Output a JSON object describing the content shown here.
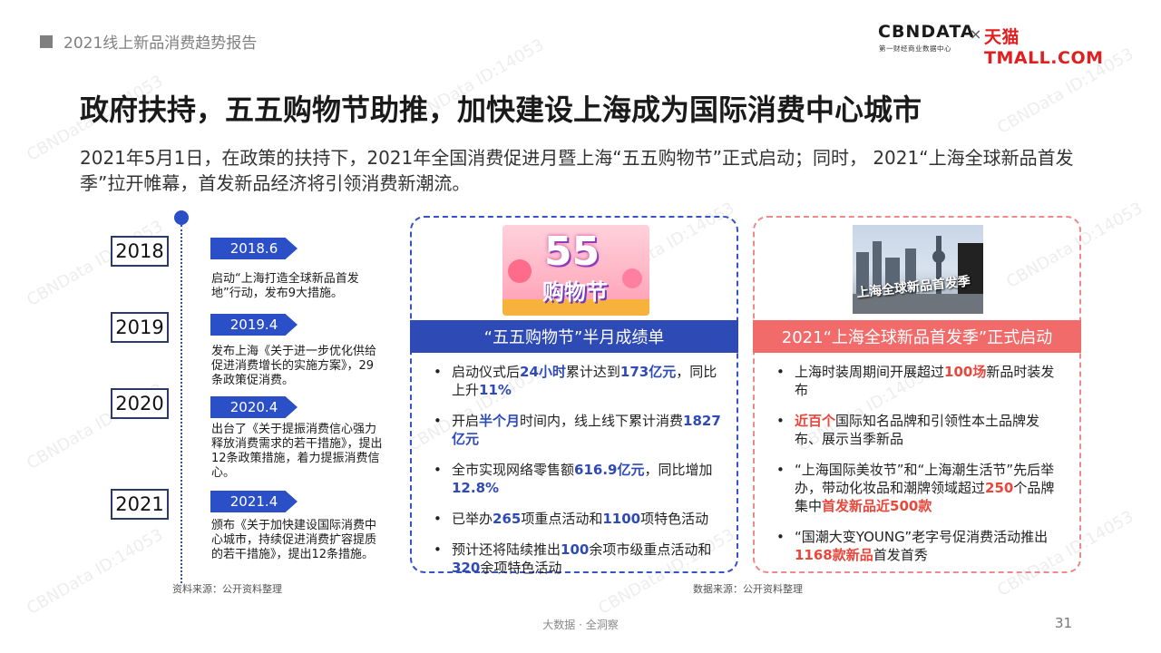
{
  "header": {
    "report_title": "2021线上新品消费趋势报告",
    "logo_cbn": "CBNDATA",
    "logo_cbn_sub": "第一财经商业数据中心",
    "logo_sep": "×",
    "logo_tmall": "天猫TMALL.COM"
  },
  "title": "政府扶持，五五购物节助推，加快建设上海成为国际消费中心城市",
  "intro": "2021年5月1日，在政策的扶持下，2021年全国消费促进月暨上海“五五购物节”正式启动；同时， 2021“上海全球新品首发季”拉开帷幕，首发新品经济将引领消费新潮流。",
  "watermark": "CBNData ID:14053",
  "timeline": [
    {
      "year": "2018",
      "date": "2018.6",
      "text": "启动“上海打造全球新品首发地”行动，发布9大措施。"
    },
    {
      "year": "2019",
      "date": "2019.4",
      "text": "发布上海《关于进一步优化供给促进消费增长的实施方案》，29条政策促消费。"
    },
    {
      "year": "2020",
      "date": "2020.4",
      "text": "出台了《关于提振消费信心强力释放消费需求的若干措施》，提出12条政策措施，着力提振消费信心。"
    },
    {
      "year": "2021",
      "date": "2021.4",
      "text": "颁布《关于加快建设国际消费中心城市，持续促进消费扩容提质的若干措施》，提出12条措施。"
    }
  ],
  "source_left": "资料来源：公开资料整理",
  "source_mid": "数据来源：公开资料整理",
  "card_left": {
    "image_text_big": "55",
    "image_text_small": "购物节",
    "banner": "“五五购物节”半月成绩单",
    "bullet": "•",
    "items": [
      [
        "启动仪式后",
        "24小时",
        "累计达到",
        "173亿元",
        "，同比上升",
        "11%",
        ""
      ],
      [
        "开启",
        "半个月",
        "时间内，线上线下累计消费",
        "1827亿元",
        "",
        "",
        ""
      ],
      [
        "全市实现网络零售额",
        "616.9亿元",
        "，同比增加",
        "12.8%",
        "",
        "",
        ""
      ],
      [
        "已举办",
        "265",
        "项重点活动和",
        "1100",
        "项特色活动",
        "",
        ""
      ],
      [
        "预计还将陆续推出",
        "100",
        "余项市级重点活动和",
        "320",
        "余项特色活动",
        "",
        ""
      ]
    ]
  },
  "card_right": {
    "image_caption": "上海全球新品首发季",
    "banner": "2021“上海全球新品首发季”正式启动",
    "bullet": "•",
    "items": [
      [
        "上海时装周期间开展超过",
        "100场",
        "新品时装发布",
        "",
        "",
        "",
        ""
      ],
      [
        "",
        "近百个",
        "国际知名品牌和引领性本土品牌发布、展示当季新品",
        "",
        "",
        "",
        ""
      ],
      [
        "“上海国际美妆节”和“上海潮生活节”先后举办，带动化妆品和潮牌领域超过",
        "250",
        "个品牌集中",
        "首发新品近500款",
        "",
        "",
        ""
      ],
      [
        "“国潮大变YOUNG”老字号促消费活动推出",
        "1168款新品",
        "首发首秀",
        "",
        "",
        "",
        ""
      ]
    ]
  },
  "footer": "大数据 · 全洞察",
  "page_number": "31"
}
